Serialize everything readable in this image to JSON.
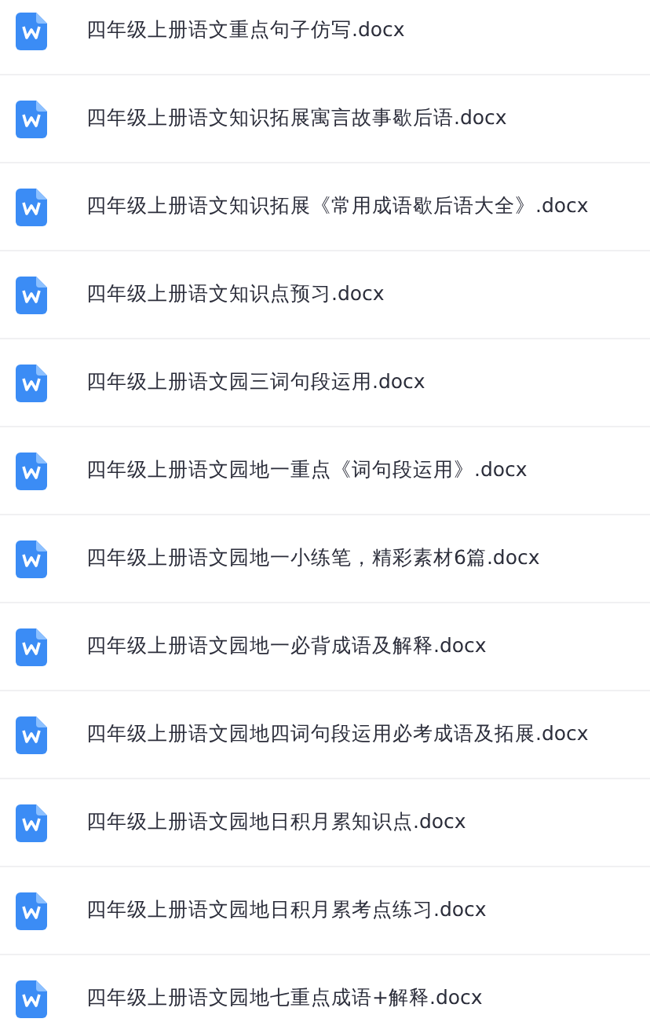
{
  "files": [
    {
      "name": "四年级上册语文重点句子仿写.docx"
    },
    {
      "name": "四年级上册语文知识拓展寓言故事歇后语.docx"
    },
    {
      "name": "四年级上册语文知识拓展《常用成语歇后语大全》.docx"
    },
    {
      "name": "四年级上册语文知识点预习.docx"
    },
    {
      "name": "四年级上册语文园三词句段运用.docx"
    },
    {
      "name": "四年级上册语文园地一重点《词句段运用》.docx"
    },
    {
      "name": "四年级上册语文园地一小练笔，精彩素材6篇.docx"
    },
    {
      "name": "四年级上册语文园地一必背成语及解释.docx"
    },
    {
      "name": "四年级上册语文园地四词句段运用必考成语及拓展.docx"
    },
    {
      "name": "四年级上册语文园地日积月累知识点.docx"
    },
    {
      "name": "四年级上册语文园地日积月累考点练习.docx"
    },
    {
      "name": "四年级上册语文园地七重点成语+解释.docx"
    }
  ]
}
